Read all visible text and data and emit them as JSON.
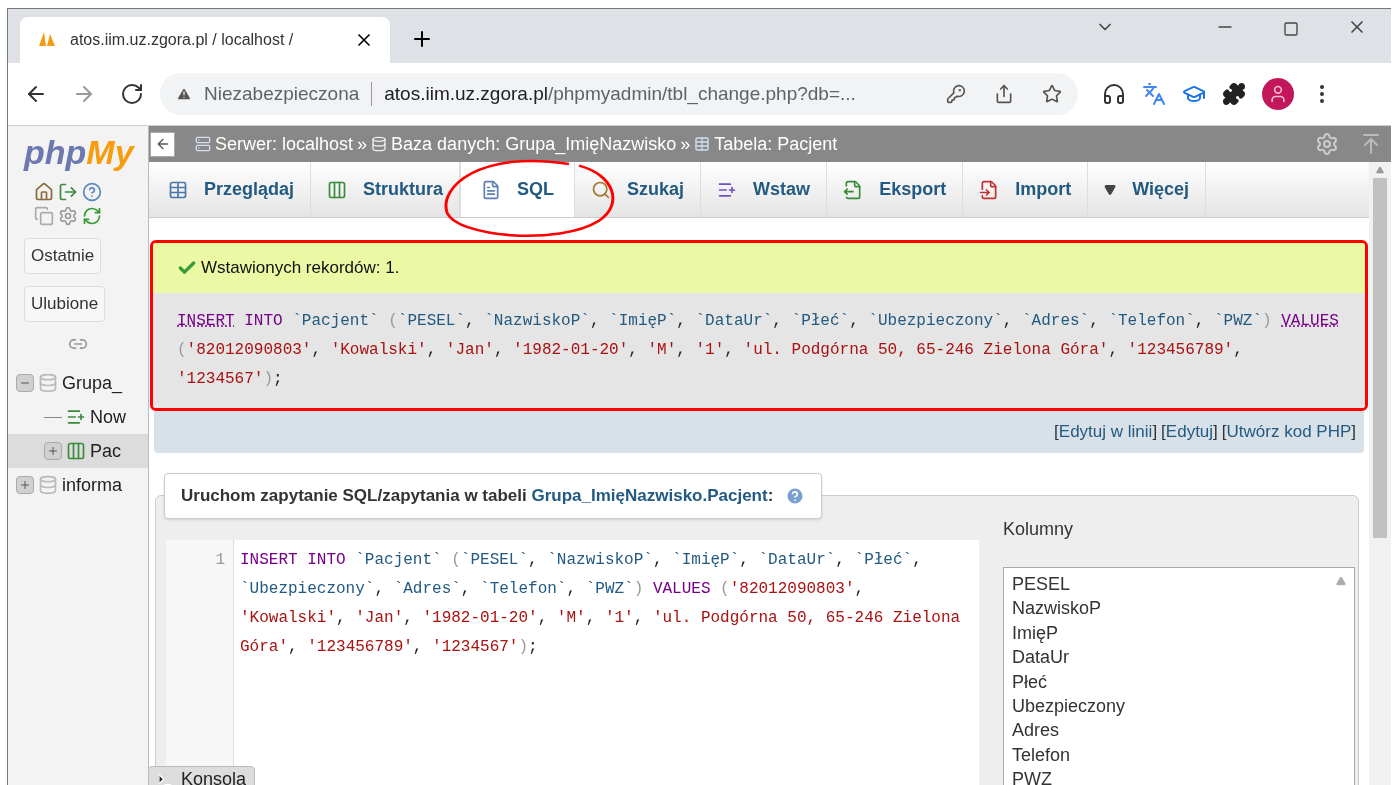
{
  "browser": {
    "tab_title": "atos.iim.uz.zgora.pl / localhost / ",
    "security": "Niezabezpieczona",
    "url_host": "atos.iim.uz.zgora.pl",
    "url_path": "/phpmyadmin/tbl_change.php?db=..."
  },
  "sidebar": {
    "logo_a": "php",
    "logo_b": "My",
    "buttons": [
      "Ostatnie",
      "Ulubione"
    ],
    "tree": [
      {
        "label": "Grupa_",
        "kind": "database",
        "expanded": true,
        "selected": false,
        "children": [
          {
            "label": "Now",
            "kind": "new",
            "selected": false
          },
          {
            "label": "Pac",
            "kind": "table",
            "expanded": false,
            "selected": true
          }
        ]
      },
      {
        "label": "informa",
        "kind": "database",
        "expanded": false,
        "selected": false
      }
    ]
  },
  "breadcrumb": [
    {
      "kind": "server",
      "label": "Serwer: localhost"
    },
    {
      "kind": "database",
      "label": "Baza danych: Grupa_ImięNazwisko"
    },
    {
      "kind": "table",
      "label": "Tabela: Pacjent"
    }
  ],
  "breadcrumb_separator": "»",
  "tabs": [
    {
      "kind": "browse",
      "label": "Przeglądaj",
      "selected": false
    },
    {
      "kind": "structure",
      "label": "Struktura",
      "selected": false
    },
    {
      "kind": "sql",
      "label": "SQL",
      "selected": true
    },
    {
      "kind": "search",
      "label": "Szukaj",
      "selected": false
    },
    {
      "kind": "insert",
      "label": "Wstaw",
      "selected": false
    },
    {
      "kind": "export",
      "label": "Eksport",
      "selected": false
    },
    {
      "kind": "import",
      "label": "Import",
      "selected": false
    },
    {
      "kind": "more",
      "label": "Więcej",
      "selected": false
    }
  ],
  "message": {
    "success": "Wstawionych rekordów: 1.",
    "query": [
      {
        "kind": "keyword_link",
        "text": "INSERT"
      },
      {
        "kind": "keyword",
        "text": " INTO "
      },
      {
        "kind": "ident",
        "text": "`Pacjent`"
      },
      {
        "kind": "paren",
        "text": " ("
      },
      {
        "kind": "ident",
        "text": "`PESEL`"
      },
      {
        "kind": "sep",
        "text": ", "
      },
      {
        "kind": "ident",
        "text": "`NazwiskoP`"
      },
      {
        "kind": "sep",
        "text": ", "
      },
      {
        "kind": "ident",
        "text": "`ImięP`"
      },
      {
        "kind": "sep",
        "text": ", "
      },
      {
        "kind": "ident",
        "text": "`DataUr`"
      },
      {
        "kind": "sep",
        "text": ", "
      },
      {
        "kind": "ident",
        "text": "`Płeć`"
      },
      {
        "kind": "sep",
        "text": ", "
      },
      {
        "kind": "ident",
        "text": "`Ubezpieczony`"
      },
      {
        "kind": "sep",
        "text": ", "
      },
      {
        "kind": "ident",
        "text": "`Adres`"
      },
      {
        "kind": "sep",
        "text": ", "
      },
      {
        "kind": "ident",
        "text": "`Telefon`"
      },
      {
        "kind": "sep",
        "text": ", "
      },
      {
        "kind": "ident",
        "text": "`PWZ`"
      },
      {
        "kind": "paren",
        "text": ") "
      },
      {
        "kind": "keyword_link",
        "text": "VALUES"
      },
      {
        "kind": "paren",
        "text": " ("
      },
      {
        "kind": "string",
        "text": "'82012090803'"
      },
      {
        "kind": "sep",
        "text": ", "
      },
      {
        "kind": "string",
        "text": "'Kowalski'"
      },
      {
        "kind": "sep",
        "text": ", "
      },
      {
        "kind": "string",
        "text": "'Jan'"
      },
      {
        "kind": "sep",
        "text": ", "
      },
      {
        "kind": "string",
        "text": "'1982-01-20'"
      },
      {
        "kind": "sep",
        "text": ", "
      },
      {
        "kind": "string",
        "text": "'M'"
      },
      {
        "kind": "sep",
        "text": ", "
      },
      {
        "kind": "string",
        "text": "'1'"
      },
      {
        "kind": "sep",
        "text": ", "
      },
      {
        "kind": "string",
        "text": "'ul. Podgórna 50, 65-246 Zielona Góra'"
      },
      {
        "kind": "sep",
        "text": ", "
      },
      {
        "kind": "string",
        "text": "'123456789'"
      },
      {
        "kind": "sep",
        "text": ", "
      },
      {
        "kind": "string",
        "text": "'1234567'"
      },
      {
        "kind": "paren",
        "text": ")"
      },
      {
        "kind": "sep",
        "text": ";"
      }
    ]
  },
  "actions": [
    {
      "open": "[",
      "label": "Edytuj w linii",
      "close": "]"
    },
    {
      "open": "[",
      "label": "Edytuj",
      "close": "]"
    },
    {
      "open": "[",
      "label": "Utwórz kod PHP",
      "close": "]"
    }
  ],
  "query_box": {
    "title": "Uruchom zapytanie SQL/zapytania w tabeli ",
    "table_link": "Grupa_ImięNazwisko.Pacjent",
    "suffix": ":",
    "line_number": "1",
    "editor": [
      {
        "kind": "keyword",
        "text": "INSERT INTO "
      },
      {
        "kind": "ident",
        "text": "`Pacjent`"
      },
      {
        "kind": "paren",
        "text": " ("
      },
      {
        "kind": "ident",
        "text": "`PESEL`"
      },
      {
        "kind": "sep",
        "text": ", "
      },
      {
        "kind": "ident",
        "text": "`NazwiskoP`"
      },
      {
        "kind": "sep",
        "text": ", "
      },
      {
        "kind": "ident",
        "text": "`ImięP`"
      },
      {
        "kind": "sep",
        "text": ", "
      },
      {
        "kind": "ident",
        "text": "`DataUr`"
      },
      {
        "kind": "sep",
        "text": ", "
      },
      {
        "kind": "ident",
        "text": "`Płeć`"
      },
      {
        "kind": "sep",
        "text": ", "
      },
      {
        "kind": "ident",
        "text": "`Ubezpieczony`"
      },
      {
        "kind": "sep",
        "text": ", "
      },
      {
        "kind": "ident",
        "text": "`Adres`"
      },
      {
        "kind": "sep",
        "text": ", "
      },
      {
        "kind": "ident",
        "text": "`Telefon`"
      },
      {
        "kind": "sep",
        "text": ", "
      },
      {
        "kind": "ident",
        "text": "`PWZ`"
      },
      {
        "kind": "paren",
        "text": ") "
      },
      {
        "kind": "keyword",
        "text": "VALUES"
      },
      {
        "kind": "paren",
        "text": " ("
      },
      {
        "kind": "string",
        "text": "'82012090803'"
      },
      {
        "kind": "sep",
        "text": ", "
      },
      {
        "kind": "string",
        "text": "'Kowalski'"
      },
      {
        "kind": "sep",
        "text": ", "
      },
      {
        "kind": "string",
        "text": "'Jan'"
      },
      {
        "kind": "sep",
        "text": ", "
      },
      {
        "kind": "string",
        "text": "'1982-01-20'"
      },
      {
        "kind": "sep",
        "text": ", "
      },
      {
        "kind": "string",
        "text": "'M'"
      },
      {
        "kind": "sep",
        "text": ", "
      },
      {
        "kind": "string",
        "text": "'1'"
      },
      {
        "kind": "sep",
        "text": ", "
      },
      {
        "kind": "string",
        "text": "'ul. Podgórna 50, 65-246 Zielona Góra'"
      },
      {
        "kind": "sep",
        "text": ", "
      },
      {
        "kind": "string",
        "text": "'123456789'"
      },
      {
        "kind": "sep",
        "text": ", "
      },
      {
        "kind": "string",
        "text": "'1234567'"
      },
      {
        "kind": "paren",
        "text": ")"
      },
      {
        "kind": "sep",
        "text": ";"
      }
    ],
    "columns_title": "Kolumny",
    "columns": [
      "PESEL",
      "NazwiskoP",
      "ImięP",
      "DataUr",
      "Płeć",
      "Ubezpieczony",
      "Adres",
      "Telefon",
      "PWZ"
    ]
  },
  "console": "Konsola"
}
